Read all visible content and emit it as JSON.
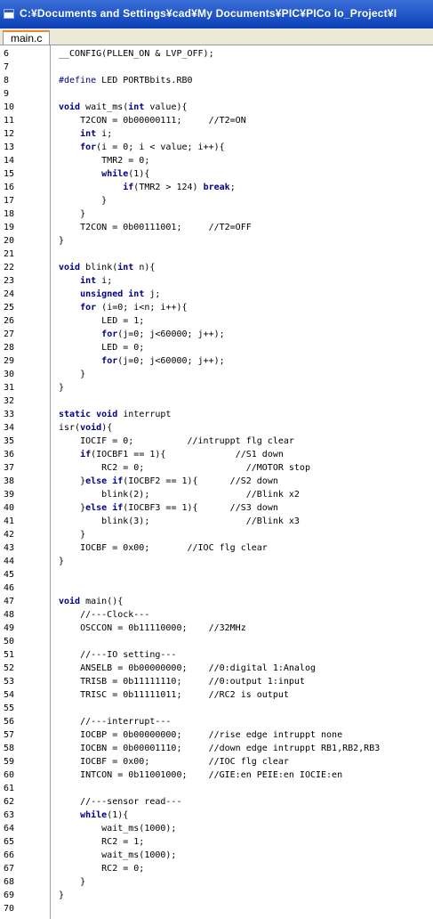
{
  "window": {
    "title": "C:¥Documents and Settings¥cad¥My Documents¥PIC¥PICo lo_Project¥I"
  },
  "tabs": [
    {
      "label": "main.c"
    }
  ],
  "editor": {
    "lines": [
      {
        "num": "6",
        "segs": [
          [
            "t",
            "__CONFIG(PLLEN_ON & LVP_OFF);"
          ]
        ]
      },
      {
        "num": "7",
        "segs": []
      },
      {
        "num": "8",
        "segs": [
          [
            "p",
            "#define"
          ],
          [
            "t",
            " LED PORTBbits.RB0"
          ]
        ]
      },
      {
        "num": "9",
        "segs": []
      },
      {
        "num": "10",
        "segs": [
          [
            "k",
            "void"
          ],
          [
            "t",
            " wait_ms("
          ],
          [
            "k",
            "int"
          ],
          [
            "t",
            " value){"
          ]
        ]
      },
      {
        "num": "11",
        "segs": [
          [
            "t",
            "    T2CON = 0b00000111;     //T2=ON"
          ]
        ]
      },
      {
        "num": "12",
        "segs": [
          [
            "t",
            "    "
          ],
          [
            "k",
            "int"
          ],
          [
            "t",
            " i;"
          ]
        ]
      },
      {
        "num": "13",
        "segs": [
          [
            "t",
            "    "
          ],
          [
            "k",
            "for"
          ],
          [
            "t",
            "(i = 0; i < value; i++){"
          ]
        ]
      },
      {
        "num": "14",
        "segs": [
          [
            "t",
            "        TMR2 = 0;"
          ]
        ]
      },
      {
        "num": "15",
        "segs": [
          [
            "t",
            "        "
          ],
          [
            "k",
            "while"
          ],
          [
            "t",
            "(1){"
          ]
        ]
      },
      {
        "num": "16",
        "segs": [
          [
            "t",
            "            "
          ],
          [
            "k",
            "if"
          ],
          [
            "t",
            "(TMR2 > 124) "
          ],
          [
            "k",
            "break"
          ],
          [
            "t",
            ";"
          ]
        ]
      },
      {
        "num": "17",
        "segs": [
          [
            "t",
            "        }"
          ]
        ]
      },
      {
        "num": "18",
        "segs": [
          [
            "t",
            "    }"
          ]
        ]
      },
      {
        "num": "19",
        "segs": [
          [
            "t",
            "    T2CON = 0b00111001;     //T2=OFF"
          ]
        ]
      },
      {
        "num": "20",
        "segs": [
          [
            "t",
            "}"
          ]
        ]
      },
      {
        "num": "21",
        "segs": []
      },
      {
        "num": "22",
        "segs": [
          [
            "k",
            "void"
          ],
          [
            "t",
            " blink("
          ],
          [
            "k",
            "int"
          ],
          [
            "t",
            " n){"
          ]
        ]
      },
      {
        "num": "23",
        "segs": [
          [
            "t",
            "    "
          ],
          [
            "k",
            "int"
          ],
          [
            "t",
            " i;"
          ]
        ]
      },
      {
        "num": "24",
        "segs": [
          [
            "t",
            "    "
          ],
          [
            "k",
            "unsigned int"
          ],
          [
            "t",
            " j;"
          ]
        ]
      },
      {
        "num": "25",
        "segs": [
          [
            "t",
            "    "
          ],
          [
            "k",
            "for"
          ],
          [
            "t",
            " (i=0; i<n; i++){"
          ]
        ]
      },
      {
        "num": "26",
        "segs": [
          [
            "t",
            "        LED = 1;"
          ]
        ]
      },
      {
        "num": "27",
        "segs": [
          [
            "t",
            "        "
          ],
          [
            "k",
            "for"
          ],
          [
            "t",
            "(j=0; j<60000; j++);"
          ]
        ]
      },
      {
        "num": "28",
        "segs": [
          [
            "t",
            "        LED = 0;"
          ]
        ]
      },
      {
        "num": "29",
        "segs": [
          [
            "t",
            "        "
          ],
          [
            "k",
            "for"
          ],
          [
            "t",
            "(j=0; j<60000; j++);"
          ]
        ]
      },
      {
        "num": "30",
        "segs": [
          [
            "t",
            "    }"
          ]
        ]
      },
      {
        "num": "31",
        "segs": [
          [
            "t",
            "}"
          ]
        ]
      },
      {
        "num": "32",
        "segs": []
      },
      {
        "num": "33",
        "segs": [
          [
            "k",
            "static void"
          ],
          [
            "t",
            " interrupt"
          ]
        ]
      },
      {
        "num": "34",
        "segs": [
          [
            "t",
            "isr("
          ],
          [
            "k",
            "void"
          ],
          [
            "t",
            "){"
          ]
        ]
      },
      {
        "num": "35",
        "segs": [
          [
            "t",
            "    IOCIF = 0;          //intruppt flg clear"
          ]
        ]
      },
      {
        "num": "36",
        "segs": [
          [
            "t",
            "    "
          ],
          [
            "k",
            "if"
          ],
          [
            "t",
            "(IOCBF1 == 1){             //S1 down"
          ]
        ]
      },
      {
        "num": "37",
        "segs": [
          [
            "t",
            "        RC2 = 0;                   //MOTOR stop"
          ]
        ]
      },
      {
        "num": "38",
        "segs": [
          [
            "t",
            "    }"
          ],
          [
            "k",
            "else if"
          ],
          [
            "t",
            "(IOCBF2 == 1){      //S2 down"
          ]
        ]
      },
      {
        "num": "39",
        "segs": [
          [
            "t",
            "        blink(2);                  //Blink x2"
          ]
        ]
      },
      {
        "num": "40",
        "segs": [
          [
            "t",
            "    }"
          ],
          [
            "k",
            "else if"
          ],
          [
            "t",
            "(IOCBF3 == 1){      //S3 down"
          ]
        ]
      },
      {
        "num": "41",
        "segs": [
          [
            "t",
            "        blink(3);                  //Blink x3"
          ]
        ]
      },
      {
        "num": "42",
        "segs": [
          [
            "t",
            "    }"
          ]
        ]
      },
      {
        "num": "43",
        "segs": [
          [
            "t",
            "    IOCBF = 0x00;       //IOC flg clear"
          ]
        ]
      },
      {
        "num": "44",
        "segs": [
          [
            "t",
            "}"
          ]
        ]
      },
      {
        "num": "45",
        "segs": []
      },
      {
        "num": "46",
        "segs": []
      },
      {
        "num": "47",
        "segs": [
          [
            "k",
            "void"
          ],
          [
            "t",
            " main(){"
          ]
        ]
      },
      {
        "num": "48",
        "segs": [
          [
            "t",
            "    //---Clock---"
          ]
        ]
      },
      {
        "num": "49",
        "segs": [
          [
            "t",
            "    OSCCON = 0b11110000;    //32MHz"
          ]
        ]
      },
      {
        "num": "50",
        "segs": []
      },
      {
        "num": "51",
        "segs": [
          [
            "t",
            "    //---IO setting---"
          ]
        ]
      },
      {
        "num": "52",
        "segs": [
          [
            "t",
            "    ANSELB = 0b00000000;    //0:digital 1:Analog"
          ]
        ]
      },
      {
        "num": "53",
        "segs": [
          [
            "t",
            "    TRISB = 0b11111110;     //0:output 1:input"
          ]
        ]
      },
      {
        "num": "54",
        "segs": [
          [
            "t",
            "    TRISC = 0b11111011;     //RC2 is output"
          ]
        ]
      },
      {
        "num": "55",
        "segs": []
      },
      {
        "num": "56",
        "segs": [
          [
            "t",
            "    //---interrupt---"
          ]
        ]
      },
      {
        "num": "57",
        "segs": [
          [
            "t",
            "    IOCBP = 0b00000000;     //rise edge intruppt none"
          ]
        ]
      },
      {
        "num": "58",
        "segs": [
          [
            "t",
            "    IOCBN = 0b00001110;     //down edge intruppt RB1,RB2,RB3"
          ]
        ]
      },
      {
        "num": "59",
        "segs": [
          [
            "t",
            "    IOCBF = 0x00;           //IOC flg clear"
          ]
        ]
      },
      {
        "num": "60",
        "segs": [
          [
            "t",
            "    INTCON = 0b11001000;    //GIE:en PEIE:en IOCIE:en"
          ]
        ]
      },
      {
        "num": "61",
        "segs": []
      },
      {
        "num": "62",
        "segs": [
          [
            "t",
            "    //---sensor read---"
          ]
        ]
      },
      {
        "num": "63",
        "segs": [
          [
            "t",
            "    "
          ],
          [
            "k",
            "while"
          ],
          [
            "t",
            "(1){"
          ]
        ]
      },
      {
        "num": "64",
        "segs": [
          [
            "t",
            "        wait_ms(1000);"
          ]
        ]
      },
      {
        "num": "65",
        "segs": [
          [
            "t",
            "        RC2 = 1;"
          ]
        ]
      },
      {
        "num": "66",
        "segs": [
          [
            "t",
            "        wait_ms(1000);"
          ]
        ]
      },
      {
        "num": "67",
        "segs": [
          [
            "t",
            "        RC2 = 0;"
          ]
        ]
      },
      {
        "num": "68",
        "segs": [
          [
            "t",
            "    }"
          ]
        ]
      },
      {
        "num": "69",
        "segs": [
          [
            "t",
            "}"
          ]
        ]
      },
      {
        "num": "70",
        "segs": []
      }
    ]
  },
  "colors": {
    "keyword": "#00008b",
    "titlebar": "#0a3fb8",
    "tab_accent": "#e68b2c"
  }
}
